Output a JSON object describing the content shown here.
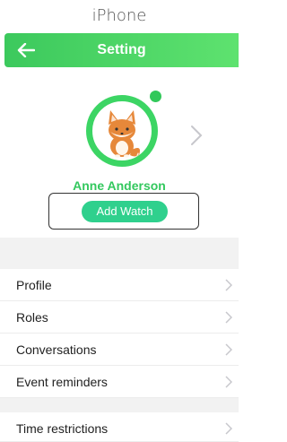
{
  "device_label": "iPhone",
  "header": {
    "title": "Setting",
    "back_icon": "arrow-left-icon"
  },
  "profile": {
    "name": "Anne Anderson",
    "add_watch_label": "Add Watch",
    "avatar_icon": "fox-avatar",
    "status": "online"
  },
  "menu_group_1": [
    {
      "label": "Profile"
    },
    {
      "label": "Roles"
    },
    {
      "label": "Conversations"
    },
    {
      "label": "Event reminders"
    }
  ],
  "menu_group_2": [
    {
      "label": "Time restrictions"
    }
  ],
  "colors": {
    "header_green": "#3cc95d",
    "accent_green": "#33c85e",
    "button_teal": "#2fd08d"
  }
}
